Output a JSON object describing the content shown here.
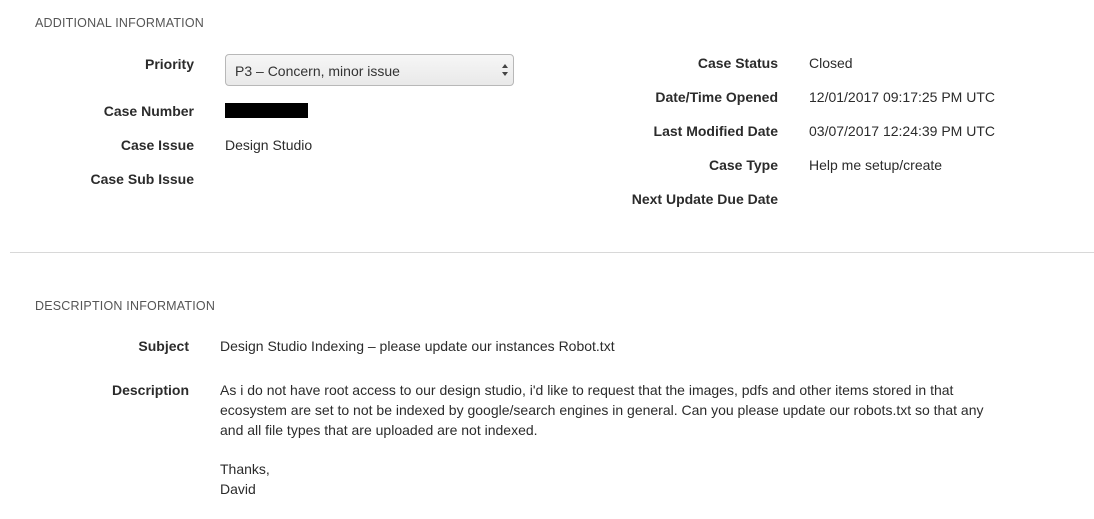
{
  "additional": {
    "title": "ADDITIONAL INFORMATION",
    "priority": {
      "label": "Priority",
      "value": "P3 – Concern, minor issue"
    },
    "case_number": {
      "label": "Case Number"
    },
    "case_issue": {
      "label": "Case Issue",
      "value": "Design Studio"
    },
    "case_sub_issue": {
      "label": "Case Sub Issue",
      "value": ""
    },
    "case_status": {
      "label": "Case Status",
      "value": "Closed"
    },
    "date_opened": {
      "label": "Date/Time Opened",
      "value": "12/01/2017 09:17:25 PM UTC"
    },
    "last_modified": {
      "label": "Last Modified Date",
      "value": "03/07/2017 12:24:39 PM UTC"
    },
    "case_type": {
      "label": "Case Type",
      "value": "Help me setup/create"
    },
    "next_update": {
      "label": "Next Update Due Date",
      "value": ""
    }
  },
  "description_info": {
    "title": "DESCRIPTION INFORMATION",
    "subject": {
      "label": "Subject",
      "value": "Design Studio Indexing – please update our instances Robot.txt"
    },
    "description": {
      "label": "Description",
      "paragraph": "As i do not have root access to our design studio, i'd like to request that the images, pdfs and other items stored in that ecosystem are set to not be indexed by google/search engines in general. Can you please update our robots.txt so that any and all file types that are uploaded are not indexed.",
      "closing": "Thanks,",
      "signature": "David"
    }
  }
}
